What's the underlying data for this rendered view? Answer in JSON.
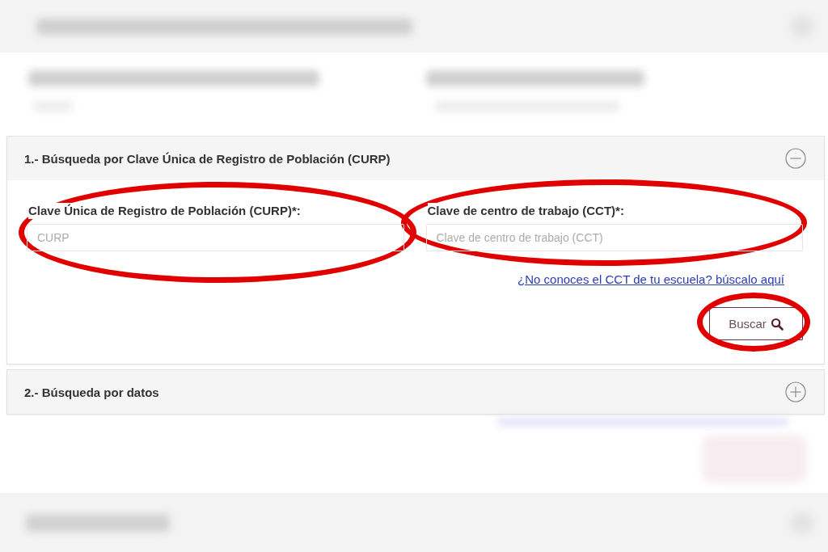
{
  "blurred_above": [
    {
      "kind": "title_bar"
    },
    {
      "kind": "field_labels"
    }
  ],
  "sections": [
    {
      "title": "1.- Búsqueda por Clave Única de Registro de Población (CURP)",
      "expanded": true,
      "fields": [
        {
          "label": "Clave Única de Registro de Población (CURP)*:",
          "placeholder": "CURP",
          "highlighted": true
        },
        {
          "label": "Clave de centro de trabajo (CCT)*:",
          "placeholder": "Clave de centro de trabajo (CCT)",
          "highlighted": true
        }
      ],
      "link": "¿No conoces el CCT de tu escuela? búscalo aquí",
      "button": {
        "label": "Buscar",
        "highlighted": true
      }
    },
    {
      "title": "2.- Búsqueda por datos",
      "expanded": false
    }
  ],
  "blurred_below": [
    {
      "kind": "link_and_button"
    },
    {
      "kind": "footer_bar"
    }
  ]
}
